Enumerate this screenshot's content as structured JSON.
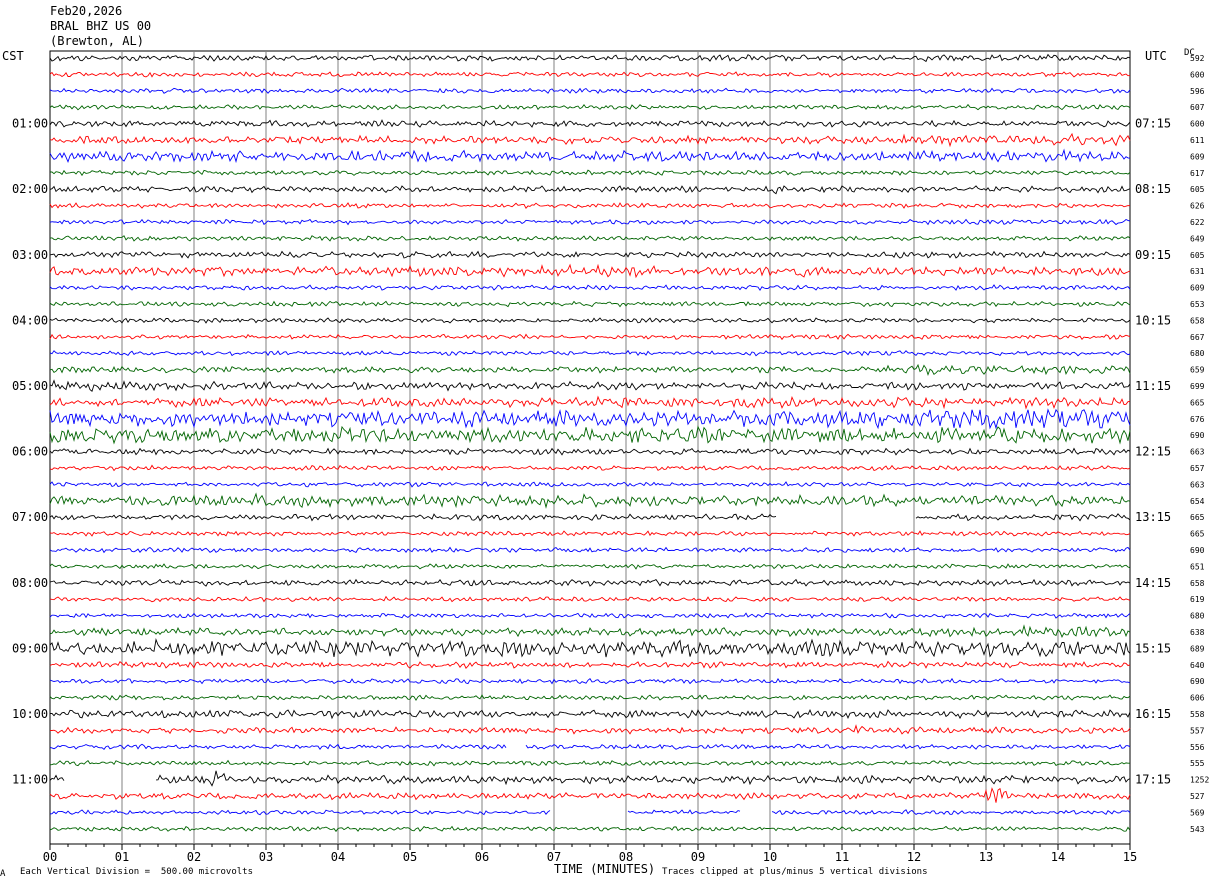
{
  "header": {
    "date": "Feb20,2026",
    "station": "BRAL BHZ US 00",
    "location": "(Brewton, AL)"
  },
  "left_timezone": "CST",
  "right_timezone": "UTC",
  "dc_label": "DC",
  "footer": {
    "scale": "Each Vertical Division =  500.00 microvolts",
    "clip": "Traces clipped at plus/minus 5 vertical divisions",
    "corner_mark": "A"
  },
  "colors": {
    "trace_cycle": [
      "#000000",
      "#ff0000",
      "#0000ff",
      "#006400"
    ],
    "grid": "#808080",
    "frame": "#000000"
  },
  "chart_data": {
    "type": "line",
    "title": "",
    "xlabel": "TIME (MINUTES)",
    "xlim": [
      0,
      15
    ],
    "x_ticks": [
      "00",
      "01",
      "02",
      "03",
      "04",
      "05",
      "06",
      "07",
      "08",
      "09",
      "10",
      "11",
      "12",
      "13",
      "14",
      "15"
    ],
    "trace_count": 48,
    "minutes_per_trace": 15,
    "left_hour_labels": [
      "01:00",
      "02:00",
      "03:00",
      "04:00",
      "05:00",
      "06:00",
      "07:00",
      "08:00",
      "09:00",
      "10:00",
      "11:00"
    ],
    "right_hour_labels": [
      "07:15",
      "08:15",
      "09:15",
      "10:15",
      "11:15",
      "12:15",
      "13:15",
      "14:15",
      "15:15",
      "16:15",
      "17:15"
    ],
    "hour_label_first_trace": 4,
    "traces_per_hour": 4,
    "dc_offsets": [
      "592",
      "600",
      "596",
      "607",
      "600",
      "611",
      "609",
      "617",
      "605",
      "626",
      "622",
      "649",
      "605",
      "631",
      "609",
      "653",
      "658",
      "667",
      "680",
      "659",
      "699",
      "665",
      "676",
      "690",
      "663",
      "657",
      "663",
      "654",
      "665",
      "665",
      "690",
      "651",
      "658",
      "619",
      "680",
      "638",
      "689",
      "640",
      "690",
      "606",
      "558",
      "557",
      "556",
      "555",
      "1252",
      "527",
      "569",
      "543"
    ],
    "amplitude": [
      2,
      1.5,
      1.5,
      1.5,
      2,
      2.5,
      3.5,
      1.5,
      2,
      1.5,
      1.5,
      1.5,
      2,
      3,
      1.5,
      1.5,
      1.5,
      1.5,
      1.5,
      2,
      2.5,
      3,
      5,
      5,
      2,
      1.5,
      1.5,
      3.5,
      2,
      1.5,
      1.5,
      1.5,
      2,
      1.5,
      1.5,
      2.5,
      5,
      2,
      1.5,
      1.5,
      2.5,
      2,
      1.5,
      1.5,
      2.5,
      2,
      1.5,
      1.5
    ],
    "bursts": [
      {
        "trace": 5,
        "start": 11.5,
        "end": 15,
        "amp": 3.5
      },
      {
        "trace": 6,
        "start": 0,
        "end": 4,
        "amp": 3.5
      },
      {
        "trace": 8,
        "start": 10.05,
        "end": 10.2,
        "amp": 4
      },
      {
        "trace": 13,
        "start": 4.5,
        "end": 10.5,
        "amp": 3.5
      },
      {
        "trace": 19,
        "start": 11.5,
        "end": 15,
        "amp": 3
      },
      {
        "trace": 20,
        "start": 0,
        "end": 1.5,
        "amp": 3.5
      },
      {
        "trace": 21,
        "start": 7,
        "end": 15,
        "amp": 3.5
      },
      {
        "trace": 22,
        "start": 11.5,
        "end": 15,
        "amp": 8
      },
      {
        "trace": 23,
        "start": 0,
        "end": 4,
        "amp": 5
      },
      {
        "trace": 27,
        "start": 2,
        "end": 8,
        "amp": 4
      },
      {
        "trace": 35,
        "start": 12.5,
        "end": 15,
        "amp": 3.5
      },
      {
        "trace": 36,
        "start": 0,
        "end": 15,
        "amp": 5
      },
      {
        "trace": 41,
        "start": 11,
        "end": 11.3,
        "amp": 4
      },
      {
        "trace": 44,
        "start": 2.2,
        "end": 2.6,
        "amp": 5
      },
      {
        "trace": 45,
        "start": 13,
        "end": 13.3,
        "amp": 6
      }
    ],
    "gaps": [
      {
        "trace": 28,
        "start": 10.1,
        "end": 12.0
      },
      {
        "trace": 44,
        "start": 0.2,
        "end": 1.45
      },
      {
        "trace": 42,
        "start": 6.35,
        "end": 6.6
      },
      {
        "trace": 46,
        "start": 6.95,
        "end": 8.0
      },
      {
        "trace": 46,
        "start": 9.6,
        "end": 10.0
      }
    ]
  }
}
